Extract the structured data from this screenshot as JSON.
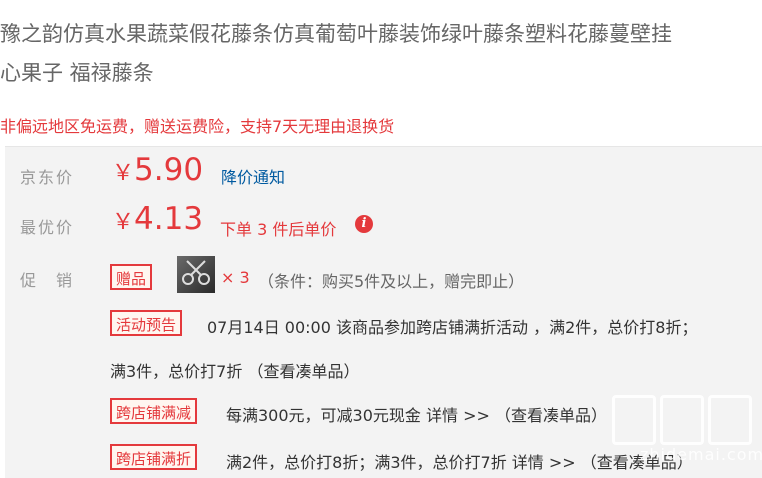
{
  "product": {
    "title_line1": "豫之韵仿真水果蔬菜假花藤条仿真葡萄叶藤装饰绿叶藤条塑料花藤蔓壁挂",
    "title_line2": "心果子 福禄藤条",
    "promo_line": "非偏远地区免运费，赠送运费险，支持7天无理由退换货"
  },
  "pricing": {
    "jd_label": "京东价",
    "currency": "￥",
    "jd_price": "5.90",
    "price_alert": "降价通知",
    "best_label": "最优价",
    "best_price": "4.13",
    "best_note": "下单 3 件后单价",
    "info_icon": "i"
  },
  "promotions": {
    "label": "促　销",
    "gift_tag": "赠品",
    "gift_qty": "× 3",
    "gift_condition": "（条件：购买5件及以上，赠完即止）",
    "activity_tag": "活动预告",
    "activity_text_line1": "07月14日 00:00 该商品参加跨店铺满折活动 ，满2件，总价打8折；",
    "activity_text_line2": "满3件，总价打7折 （查看凑单品）",
    "cross_reduce_tag": "跨店铺满减",
    "cross_reduce_text": "每满300元，可减30元现金 详情 >> （查看凑单品）",
    "cross_discount_tag": "跨店铺满折",
    "cross_discount_text": "满2件，总价打8折；满3件，总价打7折 详情 >> （查看凑单品）"
  },
  "watermark": {
    "text": "zhidemai.com",
    "icon": "watermark-logo-icon"
  },
  "colors": {
    "accent_red": "#e4393c",
    "link_blue": "#005aa0",
    "panel_bg": "#f3f3f3",
    "muted_text": "#999999"
  }
}
